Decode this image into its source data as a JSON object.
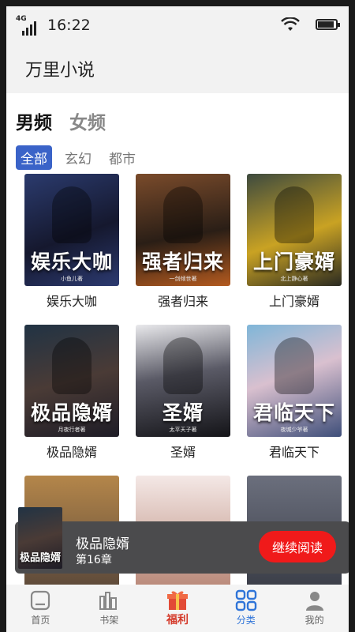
{
  "status_bar": {
    "network": "4G",
    "time": "16:22",
    "battery_level": 0.9
  },
  "app_title": "万里小说",
  "gender_tabs": [
    {
      "label": "男频",
      "active": true
    },
    {
      "label": "女频",
      "active": false
    }
  ],
  "category_tabs": [
    {
      "label": "全部",
      "active": true
    },
    {
      "label": "玄幻",
      "active": false
    },
    {
      "label": "都市",
      "active": false
    }
  ],
  "books": [
    {
      "title": "娱乐大咖",
      "cover_text": "娱乐大咖",
      "cover_sub": "小鱼儿著"
    },
    {
      "title": "强者归来",
      "cover_text": "强者归来",
      "cover_sub": "一剑倾世著"
    },
    {
      "title": "上门豪婿",
      "cover_text": "上门豪婿",
      "cover_sub": "北上静心著"
    },
    {
      "title": "极品隐婿",
      "cover_text": "极品隐婿",
      "cover_sub": "月夜行者著"
    },
    {
      "title": "圣婿",
      "cover_text": "圣婿",
      "cover_sub": "太平天子著"
    },
    {
      "title": "君临天下",
      "cover_text": "君临天下",
      "cover_sub": "夜城少爷著"
    },
    {
      "title": "",
      "cover_text": "",
      "cover_sub": ""
    },
    {
      "title": "",
      "cover_text": "",
      "cover_sub": ""
    },
    {
      "title": "",
      "cover_text": "",
      "cover_sub": ""
    }
  ],
  "continue_reading": {
    "title": "极品隐婿",
    "chapter": "第16章",
    "cover_text": "极品隐婿",
    "button_label": "继续阅读"
  },
  "bottom_tabs": [
    {
      "label": "首页",
      "icon": "home-icon",
      "active": false
    },
    {
      "label": "书架",
      "icon": "bookshelf-icon",
      "active": false
    },
    {
      "label": "福利",
      "icon": "gift-icon",
      "active": false
    },
    {
      "label": "分类",
      "icon": "category-icon",
      "active": true
    },
    {
      "label": "我的",
      "icon": "profile-icon",
      "active": false
    }
  ],
  "colors": {
    "accent": "#3a63c8",
    "cta": "#f01a1a",
    "tab_active": "#2f74d8",
    "welfare": "#d43a2a"
  }
}
